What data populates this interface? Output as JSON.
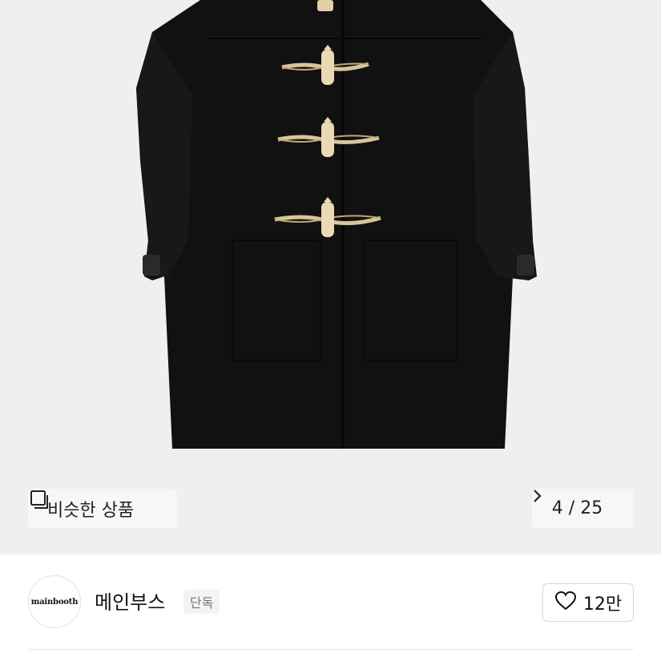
{
  "product": {
    "image_icon": "duffle-coat-photo",
    "similar_button": {
      "label": "비슷한 상품",
      "icon": "similar-items-icon"
    },
    "counter": {
      "text": "4 / 25",
      "icon": "chevron-right-icon"
    }
  },
  "store": {
    "logo_text": "mainbooth",
    "name": "메인부스",
    "badge": "단독",
    "like": {
      "icon": "heart-icon",
      "count": "12만"
    }
  }
}
